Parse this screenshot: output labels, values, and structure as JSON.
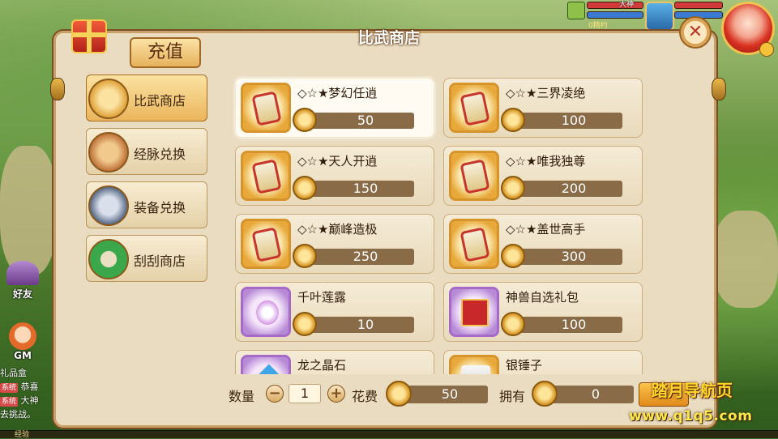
{
  "hud": {
    "bar_colors": [
      "#d23a3a",
      "#3a7ad2",
      "#d23a3a",
      "#3a7ad2"
    ],
    "other_name": "大神",
    "gold_text": "0精约"
  },
  "panel": {
    "title": "比武商店",
    "recharge_label": "充值",
    "close_glyph": "✕"
  },
  "nav": [
    {
      "label": "比武商店",
      "icon": "shop-emblem-icon",
      "active": true,
      "color": "#e0a23a"
    },
    {
      "label": "经脉兑换",
      "icon": "meridian-emblem-icon",
      "active": false,
      "color": "#c0743a"
    },
    {
      "label": "装备兑换",
      "icon": "equipment-emblem-icon",
      "active": false,
      "color": "#5a6a86"
    },
    {
      "label": "刮刮商店",
      "icon": "scratch-emblem-icon",
      "active": false,
      "color": "#3aa84a"
    }
  ],
  "items": [
    {
      "name": "◇☆★梦幻任逍",
      "price": "50",
      "thumb": "gold scroll",
      "icon": "scroll-icon",
      "selected": true
    },
    {
      "name": "◇☆★三界凌绝",
      "price": "100",
      "thumb": "gold scroll",
      "icon": "scroll-icon",
      "selected": false
    },
    {
      "name": "◇☆★天人开逍",
      "price": "150",
      "thumb": "gold scroll",
      "icon": "scroll-icon",
      "selected": false
    },
    {
      "name": "◇☆★唯我独尊",
      "price": "200",
      "thumb": "gold scroll",
      "icon": "scroll-icon",
      "selected": false
    },
    {
      "name": "◇☆★巅峰造极",
      "price": "250",
      "thumb": "gold scroll",
      "icon": "scroll-icon",
      "selected": false
    },
    {
      "name": "◇☆★盖世高手",
      "price": "300",
      "thumb": "gold scroll",
      "icon": "scroll-icon",
      "selected": false
    },
    {
      "name": "千叶莲露",
      "price": "10",
      "thumb": "purple dew",
      "icon": "lotus-dew-icon",
      "selected": false
    },
    {
      "name": "神兽自选礼包",
      "price": "100",
      "thumb": "purple box",
      "icon": "gift-box-icon",
      "selected": false
    },
    {
      "name": "龙之晶石",
      "price": "",
      "thumb": "purple crystal",
      "icon": "crystal-icon",
      "selected": false
    },
    {
      "name": "银锤子",
      "price": "",
      "thumb": "gold silver",
      "icon": "hammer-icon",
      "selected": false
    }
  ],
  "footer": {
    "qty_label": "数量",
    "minus": "−",
    "qty": "1",
    "plus": "+",
    "cost_label": "花费",
    "cost": "50",
    "own_label": "拥有",
    "own": "0"
  },
  "side": {
    "friend_label": "好友",
    "gm_label": "GM",
    "chat": [
      {
        "tag": "",
        "text": "礼品盒"
      },
      {
        "tag": "系统",
        "text": "恭喜"
      },
      {
        "tag": "系统",
        "text": "大神"
      },
      {
        "tag": "",
        "text": "去挑战。"
      }
    ],
    "xp_label": "经验"
  },
  "watermark": {
    "title": "踏月导航页",
    "url": "www.q1q5.com"
  }
}
